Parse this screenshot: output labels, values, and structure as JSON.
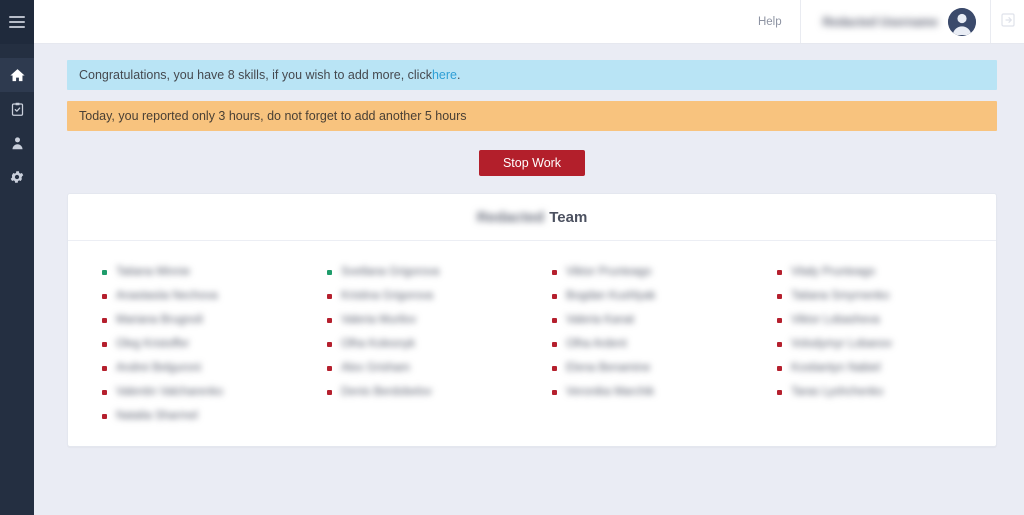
{
  "sidebar": {
    "menu_toggle_label": "Menu",
    "items": [
      {
        "id": "dashboard",
        "icon": "home-icon",
        "label": "Dashboard",
        "active": true
      },
      {
        "id": "timesheet",
        "icon": "clipboard-check-icon",
        "label": "Timesheet",
        "active": false
      },
      {
        "id": "profile",
        "icon": "user-icon",
        "label": "Profile",
        "active": false
      },
      {
        "id": "settings",
        "icon": "gear-icon",
        "label": "Settings",
        "active": false
      }
    ]
  },
  "topbar": {
    "help_label": "Help",
    "user_name": "Redacted Username",
    "avatar_icon": "avatar-icon",
    "logout_icon": "sign-out-icon"
  },
  "alerts": {
    "info": {
      "text_before": "Congratulations, you have 8 skills, if you wish to add more, click ",
      "link_text": "here",
      "text_after": ".",
      "background": "#b9e4f5",
      "link_color": "#2f9fd6"
    },
    "warning": {
      "text": "Today, you reported only 3 hours, do not forget to add another 5 hours",
      "background": "#f8c37e"
    }
  },
  "action": {
    "stop_work_label": "Stop Work",
    "stop_work_color": "#b31f2b"
  },
  "team_card": {
    "title_prefix": "Redacted",
    "title_suffix": "Team",
    "status_colors": {
      "online": "#1e9c6b",
      "offline": "#b5202e"
    },
    "columns": [
      {
        "members": [
          {
            "name": "Tatiana Minnie",
            "status": "online"
          },
          {
            "name": "Anastasiia Nechova",
            "status": "offline"
          },
          {
            "name": "Mariana Brugnoli",
            "status": "offline"
          },
          {
            "name": "Oleg Kristoffer",
            "status": "offline"
          },
          {
            "name": "Andrei Belguroni",
            "status": "offline"
          },
          {
            "name": "Valentin Valcharenko",
            "status": "offline"
          },
          {
            "name": "Natalia Sharmel",
            "status": "offline"
          }
        ]
      },
      {
        "members": [
          {
            "name": "Svetlana Grigorova",
            "status": "online"
          },
          {
            "name": "Kristina Grigorova",
            "status": "offline"
          },
          {
            "name": "Valeria Murilov",
            "status": "offline"
          },
          {
            "name": "Olha Kolesnyk",
            "status": "offline"
          },
          {
            "name": "Alex Grisham",
            "status": "offline"
          },
          {
            "name": "Denis Berdobelov",
            "status": "offline"
          }
        ]
      },
      {
        "members": [
          {
            "name": "Viktor Prunteago",
            "status": "offline"
          },
          {
            "name": "Bogdan Kushlyak",
            "status": "offline"
          },
          {
            "name": "Valeria Kanat",
            "status": "offline"
          },
          {
            "name": "Olha Ardent",
            "status": "offline"
          },
          {
            "name": "Elena Benamine",
            "status": "offline"
          },
          {
            "name": "Veronika Marchik",
            "status": "offline"
          }
        ]
      },
      {
        "members": [
          {
            "name": "Vitaly Prunteago",
            "status": "offline"
          },
          {
            "name": "Tatiana Smyrnenko",
            "status": "offline"
          },
          {
            "name": "Viktor Lobasheva",
            "status": "offline"
          },
          {
            "name": "Volodymyr Lobanov",
            "status": "offline"
          },
          {
            "name": "Kostiantyn Nabiel",
            "status": "offline"
          },
          {
            "name": "Taras Lyshchenko",
            "status": "offline"
          }
        ]
      }
    ]
  }
}
